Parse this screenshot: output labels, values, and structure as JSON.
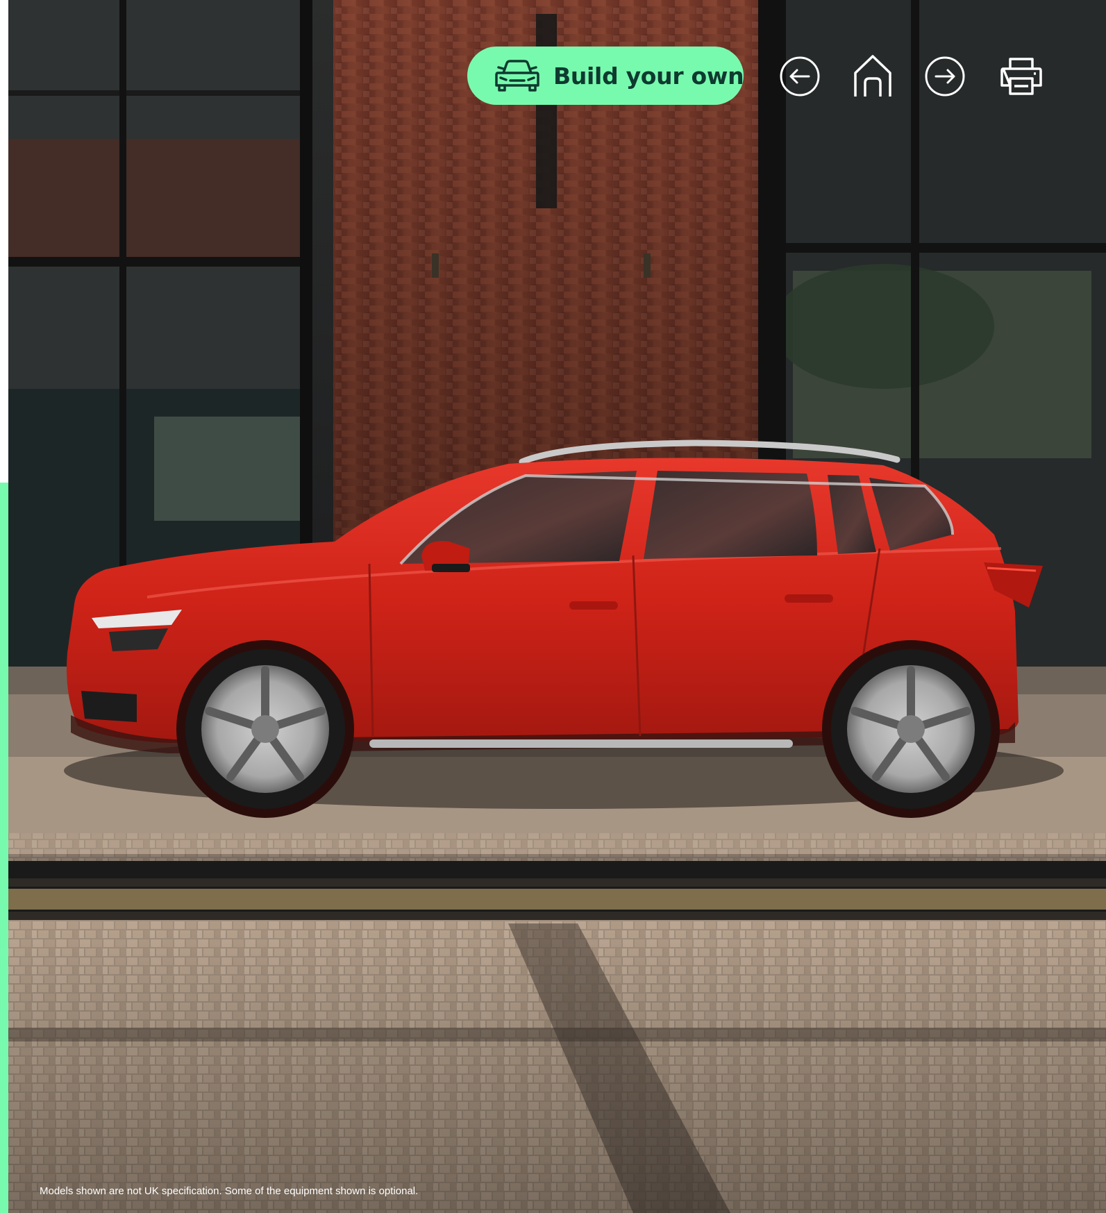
{
  "toolbar": {
    "build_label": "Build your own",
    "build_icon": "car-front-icon",
    "back_icon": "arrow-left-circle-icon",
    "home_icon": "home-icon",
    "forward_icon": "arrow-right-circle-icon",
    "print_icon": "printer-icon"
  },
  "footer": {
    "disclaimer": "Models shown are not UK specification. Some of the equipment shown is optional."
  },
  "colors": {
    "accent": "#78faae",
    "accent_text": "#0e3a2f",
    "car_body": "#d7261c",
    "brick": "#7a3a2c"
  }
}
